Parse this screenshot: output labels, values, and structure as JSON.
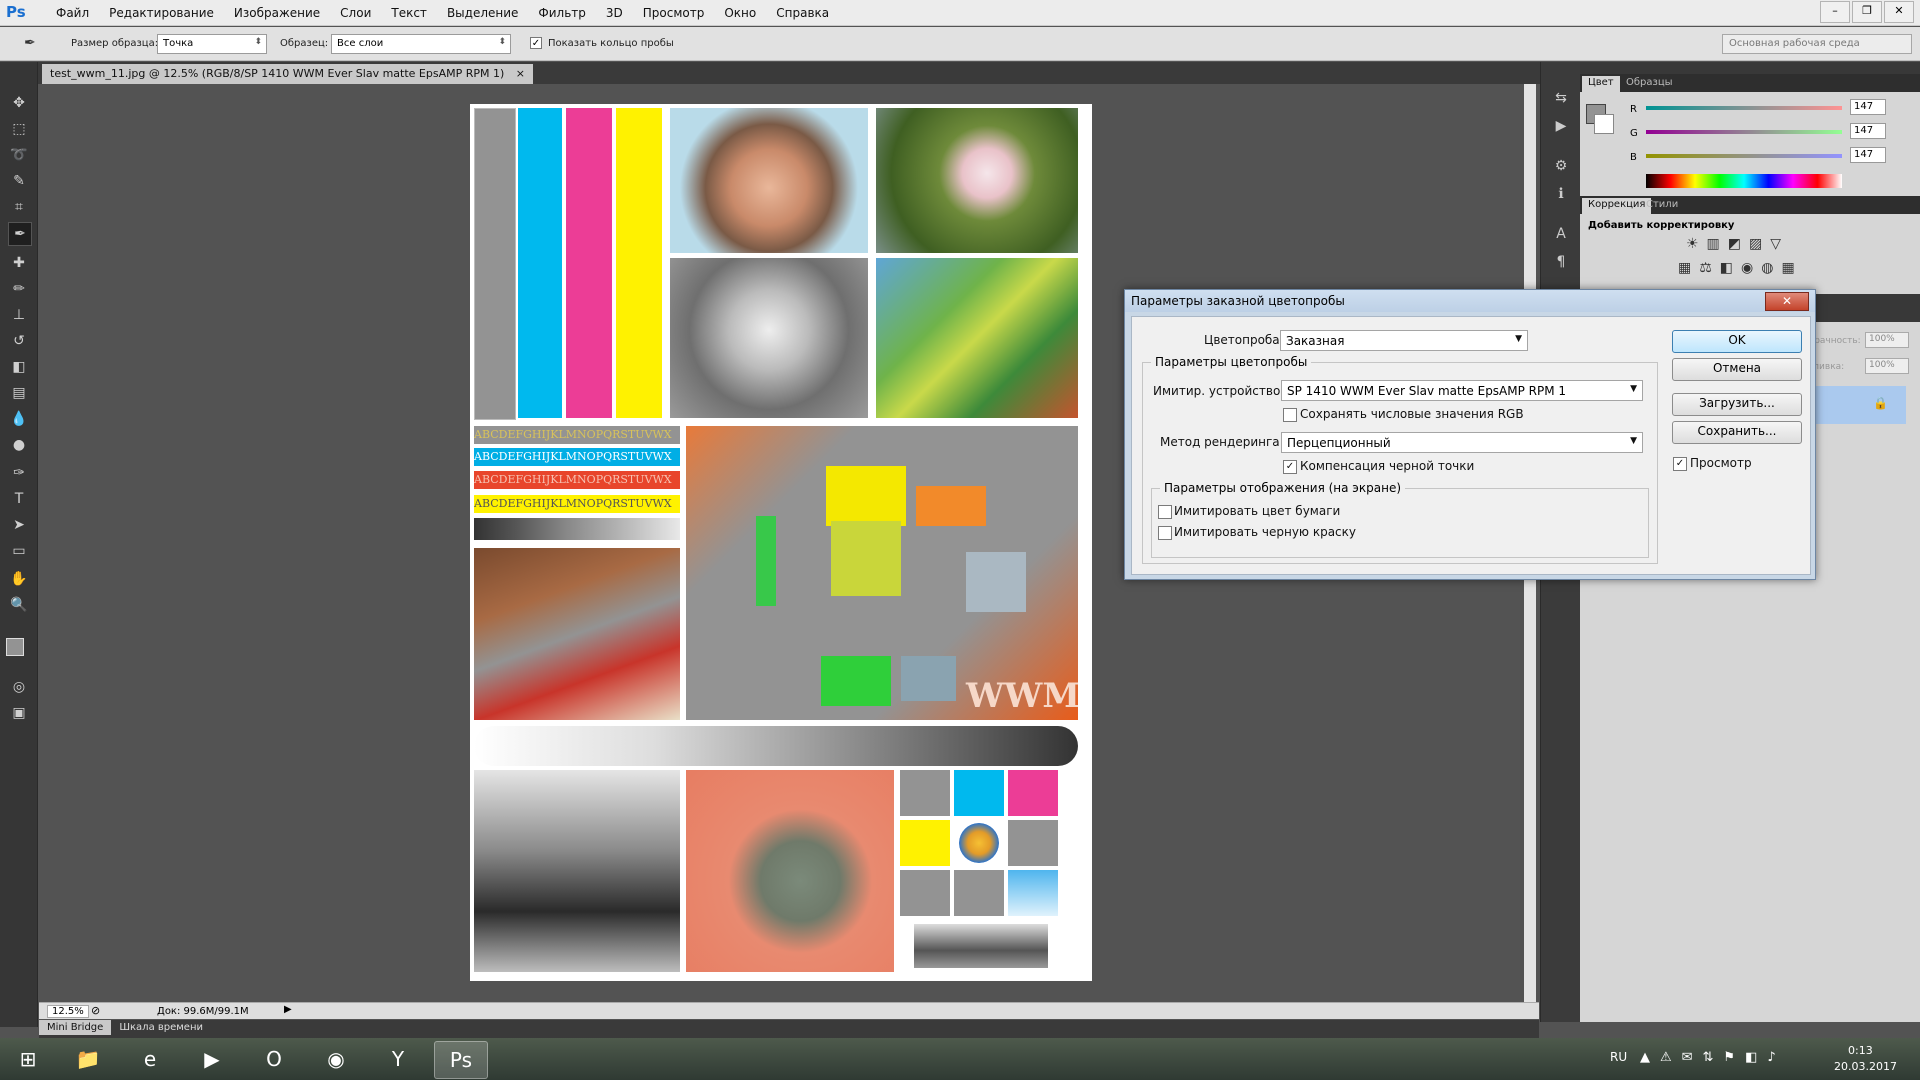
{
  "app": {
    "logo": "Ps",
    "menus": [
      "Файл",
      "Редактирование",
      "Изображение",
      "Слои",
      "Текст",
      "Выделение",
      "Фильтр",
      "3D",
      "Просмотр",
      "Окно",
      "Справка"
    ],
    "window_controls": [
      "–",
      "❐",
      "✕"
    ]
  },
  "options_bar": {
    "sample_size_label": "Размер образца:",
    "sample_size_value": "Точка",
    "sample_label": "Образец:",
    "sample_value": "Все слои",
    "show_ring_label": "Показать кольцо пробы",
    "show_ring_checked": true,
    "workspace": "Основная рабочая среда"
  },
  "document": {
    "tab_title": "test_wwm_11.jpg @ 12.5% (RGB/8/SP 1410 WWM Ever Slav matte EpsAMP RPM 1)",
    "tab_close": "×",
    "zoom": "12.5%",
    "doc_size": "Док: 99.6M/99.1M",
    "text_rows": [
      "ABCDEFGHIJKLMNOPQRSTUVWX",
      "ABCDEFGHIJKLMNOPQRSTUVWX",
      "ABCDEFGHIJKLMNOPQRSTUVWX",
      "ABCDEFGHIJKLMNOPQRSTUVWX"
    ],
    "watermark": "WWM"
  },
  "bottom_tabs": [
    "Mini Bridge",
    "Шкала времени"
  ],
  "panels": {
    "color_tabs": [
      "Цвет",
      "Образцы"
    ],
    "channels": [
      {
        "label": "R",
        "value": "147"
      },
      {
        "label": "G",
        "value": "147"
      },
      {
        "label": "B",
        "value": "147"
      }
    ],
    "adjust_tabs": [
      "Коррекция",
      "Стили"
    ],
    "adjust_title": "Добавить корректировку",
    "opacity_label": "Непрозрачность:",
    "opacity_value": "100%",
    "fill_label": "Заливка:",
    "fill_value": "100%"
  },
  "dialog": {
    "title": "Параметры заказной цветопробы",
    "close": "✕",
    "proof_label": "Цветопроба:",
    "proof_value": "Заказная",
    "group1_title": "Параметры цветопробы",
    "device_label": "Имитир. устройство:",
    "device_value": "SP 1410 WWM Ever Slav matte EpsAMP RPM 1",
    "preserve_rgb_label": "Сохранять числовые значения RGB",
    "preserve_rgb_checked": false,
    "render_label": "Метод рендеринга:",
    "render_value": "Перцепционный",
    "bpc_label": "Компенсация черной точки",
    "bpc_checked": true,
    "group2_title": "Параметры отображения (на экране)",
    "paper_label": "Имитировать цвет бумаги",
    "paper_checked": false,
    "ink_label": "Имитировать черную краску",
    "ink_checked": false,
    "ok": "OK",
    "cancel": "Отмена",
    "load": "Загрузить...",
    "save": "Сохранить...",
    "preview_label": "Просмотр",
    "preview_checked": true
  },
  "taskbar": {
    "lang": "RU",
    "time": "0:13",
    "date": "20.03.2017"
  },
  "colors": {
    "cyan": "#00b9ee",
    "magenta": "#ec3d96",
    "yellow": "#fff200",
    "gray": "#939393",
    "orange": "#e85c1a"
  }
}
